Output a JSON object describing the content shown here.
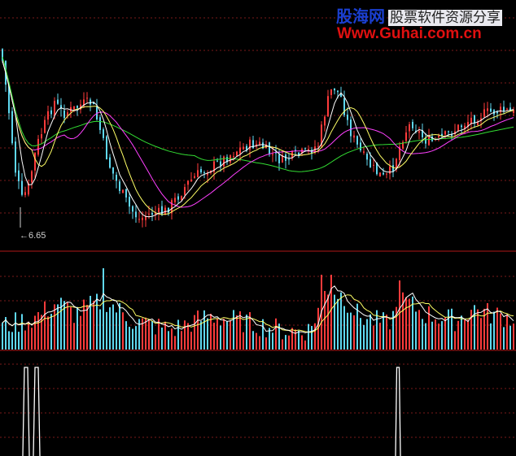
{
  "watermark": {
    "site_name": "股海网",
    "slogan": "股票软件资源分享",
    "url": "Www.Guhai.com.cn"
  },
  "low_marker_label": "←6.65",
  "colors": {
    "up": "#ff3b3b",
    "down": "#5fd8f0",
    "ma_white": "#ffffff",
    "ma_yellow": "#ffff66",
    "ma_magenta": "#ff40ff",
    "ma_green": "#33dd33",
    "grid": "#7a1a1a",
    "separator": "#b01818"
  },
  "chart_data": [
    {
      "type": "candlestick",
      "panel": "price",
      "series": [
        {
          "name": "MA5",
          "color": "white"
        },
        {
          "name": "MA10",
          "color": "yellow"
        },
        {
          "name": "MA20",
          "color": "magenta"
        },
        {
          "name": "MA60",
          "color": "green"
        }
      ],
      "annotations": [
        "6.65"
      ],
      "grid": true
    },
    {
      "type": "bar",
      "panel": "volume",
      "series": [
        {
          "name": "MA5",
          "color": "white"
        },
        {
          "name": "MA10",
          "color": "yellow"
        }
      ],
      "grid": true
    },
    {
      "type": "line",
      "panel": "signal",
      "spikes": 3,
      "grid": true
    }
  ]
}
